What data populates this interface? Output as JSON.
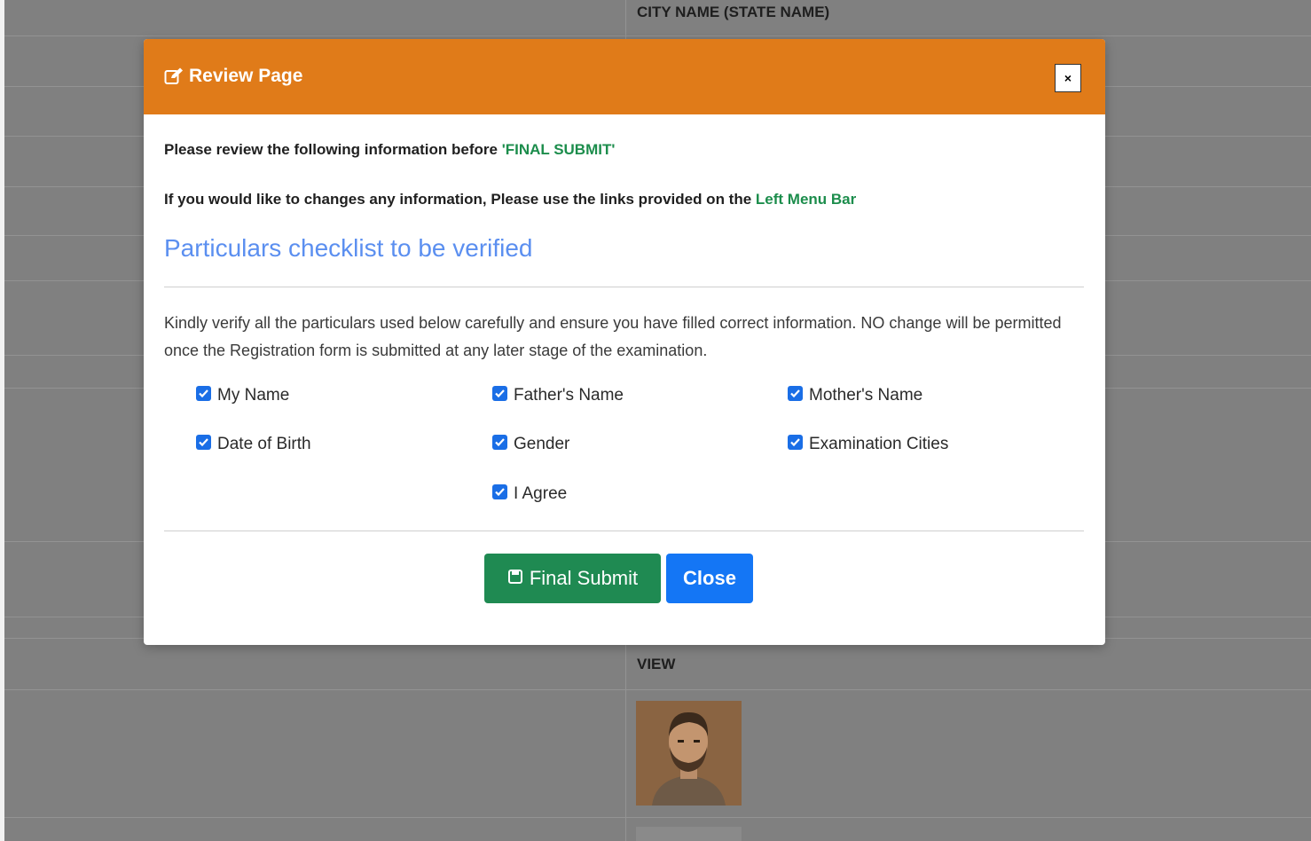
{
  "background": {
    "city_header": "CITY NAME (STATE NAME)",
    "view_label": "VIEW"
  },
  "modal": {
    "title": "Review Page",
    "close_symbol": "×",
    "review_text": "Please review the following information before ",
    "final_submit_quote": "'FINAL SUBMIT'",
    "change_text": "If you would like to changes any information, Please use the links provided on the ",
    "left_menu_link": "Left Menu Bar",
    "section_title": "Particulars checklist to be verified",
    "description": "Kindly verify all the particulars used below carefully and ensure you have filled correct information. NO change will be permitted once the Registration form is submitted at any later stage of the examination.",
    "checklist": [
      {
        "label": "My Name",
        "checked": true
      },
      {
        "label": "Father's Name",
        "checked": true
      },
      {
        "label": "Mother's Name",
        "checked": true
      },
      {
        "label": "Date of Birth",
        "checked": true
      },
      {
        "label": "Gender",
        "checked": true
      },
      {
        "label": "Examination Cities",
        "checked": true
      },
      {
        "label": "I Agree",
        "checked": true
      }
    ],
    "buttons": {
      "final_submit": "Final Submit",
      "close": "Close"
    }
  },
  "colors": {
    "header": "#e07b19",
    "accent_green": "#1c8d4c",
    "title_blue": "#5b8ff0",
    "close_blue": "#1476f5",
    "submit_green": "#1f8a52"
  }
}
